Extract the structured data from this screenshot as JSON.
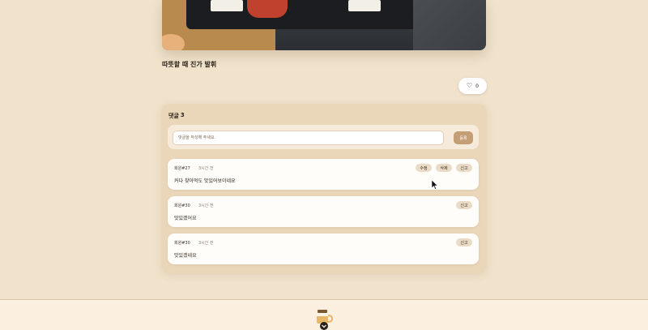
{
  "post": {
    "title": "따뜻할 때 진가 발휘",
    "like_count": "0"
  },
  "comments_section": {
    "heading": "댓글",
    "count": "3",
    "input_placeholder": "댓글을 작성해 주세요.",
    "submit_label": "등록"
  },
  "comments": [
    {
      "author": "회원#27",
      "time": "3시간 전",
      "body": "커다 찾아먹도 맛있어보이네요",
      "actions": [
        "수정",
        "삭제",
        "신고"
      ]
    },
    {
      "author": "회원#30",
      "time": "3시간 전",
      "body": "맛있겠어요",
      "actions": [
        "신고"
      ]
    },
    {
      "author": "회원#30",
      "time": "3시간 전",
      "body": "맛있겠네요",
      "actions": [
        "신고"
      ]
    }
  ],
  "colors": {
    "background": "#f0e2cb",
    "panel": "#ead7ba",
    "accent": "#c49f76",
    "card": "#fffdfa"
  },
  "icons": {
    "like": "heart-icon",
    "cursor": "mouse-pointer-icon",
    "footer": "coffee-cup-logo-icon"
  }
}
